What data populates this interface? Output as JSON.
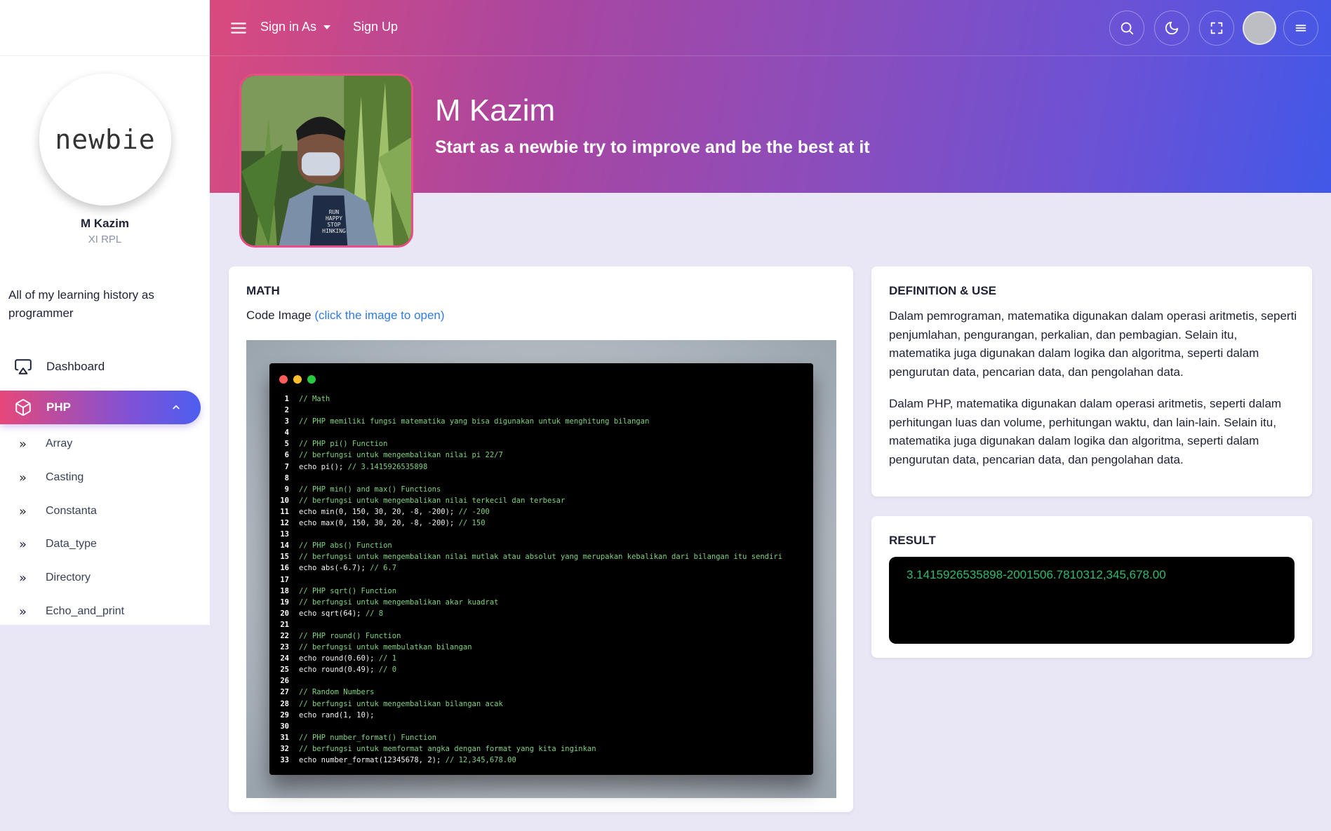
{
  "nav": {
    "sign_in_label": "Sign in As",
    "sign_up_label": "Sign Up"
  },
  "sidebar": {
    "logo_text": "newbie",
    "user_name": "M Kazim",
    "user_class": "XI RPL",
    "description": "All of my learning history as programmer",
    "dashboard_label": "Dashboard",
    "php_label": "PHP",
    "sub_items": [
      "Array",
      "Casting",
      "Constanta",
      "Data_type",
      "Directory",
      "Echo_and_print"
    ]
  },
  "profile": {
    "name": "M Kazim",
    "bio": "Start as a newbie try to improve and be the best at it",
    "photo_shirt_text": [
      "RUN",
      "HAPPY",
      "STOP",
      "HINKING"
    ]
  },
  "math_card": {
    "title": "MATH",
    "code_label": "Code Image ",
    "code_link": "(click the image to open)"
  },
  "code_lines": [
    {
      "n": "1",
      "t": "// Math",
      "k": "cm"
    },
    {
      "n": "2",
      "t": "",
      "k": "cd"
    },
    {
      "n": "3",
      "t": "// PHP memiliki fungsi matematika yang bisa digunakan untuk menghitung bilangan",
      "k": "cm"
    },
    {
      "n": "4",
      "t": "",
      "k": "cd"
    },
    {
      "n": "5",
      "t": "// PHP pi() Function",
      "k": "cm"
    },
    {
      "n": "6",
      "t": "// berfungsi untuk mengembalikan nilai pi 22/7",
      "k": "cm"
    },
    {
      "n": "7",
      "t": "echo pi();",
      "c": " // 3.1415926535898",
      "k": "cd"
    },
    {
      "n": "8",
      "t": "",
      "k": "cd"
    },
    {
      "n": "9",
      "t": "// PHP min() and max() Functions",
      "k": "cm"
    },
    {
      "n": "10",
      "t": "// berfungsi untuk mengembalikan nilai terkecil dan terbesar",
      "k": "cm"
    },
    {
      "n": "11",
      "t": "echo min(0, 150, 30, 20, -8, -200);",
      "c": " // -200",
      "k": "cd"
    },
    {
      "n": "12",
      "t": "echo max(0, 150, 30, 20, -8, -200);",
      "c": " // 150",
      "k": "cd"
    },
    {
      "n": "13",
      "t": "",
      "k": "cd"
    },
    {
      "n": "14",
      "t": "// PHP abs() Function",
      "k": "cm"
    },
    {
      "n": "15",
      "t": "// berfungsi untuk mengembalikan nilai mutlak atau absolut yang merupakan kebalikan dari bilangan itu sendiri",
      "k": "cm"
    },
    {
      "n": "16",
      "t": "echo abs(-6.7);",
      "c": " // 6.7",
      "k": "cd"
    },
    {
      "n": "17",
      "t": "",
      "k": "cd"
    },
    {
      "n": "18",
      "t": "// PHP sqrt() Function",
      "k": "cm"
    },
    {
      "n": "19",
      "t": "// berfungsi untuk mengembalikan akar kuadrat",
      "k": "cm"
    },
    {
      "n": "20",
      "t": "echo sqrt(64);",
      "c": " // 8",
      "k": "cd"
    },
    {
      "n": "21",
      "t": "",
      "k": "cd"
    },
    {
      "n": "22",
      "t": "// PHP round() Function",
      "k": "cm"
    },
    {
      "n": "23",
      "t": "// berfungsi untuk membulatkan bilangan",
      "k": "cm"
    },
    {
      "n": "24",
      "t": "echo round(0.60);",
      "c": " // 1",
      "k": "cd"
    },
    {
      "n": "25",
      "t": "echo round(0.49);",
      "c": " // 0",
      "k": "cd"
    },
    {
      "n": "26",
      "t": "",
      "k": "cd"
    },
    {
      "n": "27",
      "t": "// Random Numbers",
      "k": "cm"
    },
    {
      "n": "28",
      "t": "// berfungsi untuk mengembalikan bilangan acak",
      "k": "cm"
    },
    {
      "n": "29",
      "t": "echo rand(1, 10);",
      "k": "cd"
    },
    {
      "n": "30",
      "t": "",
      "k": "cd"
    },
    {
      "n": "31",
      "t": "// PHP number_format() Function",
      "k": "cm"
    },
    {
      "n": "32",
      "t": "// berfungsi untuk memformat angka dengan format yang kita inginkan",
      "k": "cm"
    },
    {
      "n": "33",
      "t": "echo number_format(12345678, 2);",
      "c": " // 12,345,678.00",
      "k": "cd"
    }
  ],
  "definition_card": {
    "title": "DEFINITION & USE",
    "paragraph1": "Dalam pemrograman, matematika digunakan dalam operasi aritmetis, seperti penjumlahan, pengurangan, perkalian, dan pembagian. Selain itu, matematika juga digunakan dalam logika dan algoritma, seperti dalam pengurutan data, pencarian data, dan pengolahan data.",
    "paragraph2": "Dalam PHP, matematika digunakan dalam operasi aritmetis, seperti dalam perhitungan luas dan volume, perhitungan waktu, dan lain-lain. Selain itu, matematika juga digunakan dalam logika dan algoritma, seperti dalam pengurutan data, pencarian data, dan pengolahan data."
  },
  "result_card": {
    "title": "RESULT",
    "output": "3.1415926535898-2001506.7810312,345,678.00"
  },
  "icons": {
    "menu": "hamburger-icon",
    "search": "search-icon",
    "theme": "moon-icon",
    "fullscreen": "fullscreen-icon",
    "more": "menu-lines-icon",
    "dashboard": "monitor-icon",
    "php": "cube-icon",
    "chevron": "chevron-up-icon",
    "sub": "double-chevron-right-icon"
  },
  "colors": {
    "accent_pink": "#e6487a",
    "accent_blue": "#4158e8",
    "link": "#2f7be5",
    "result_text": "#2dbd6e",
    "page_bg": "#e9e6f5"
  }
}
